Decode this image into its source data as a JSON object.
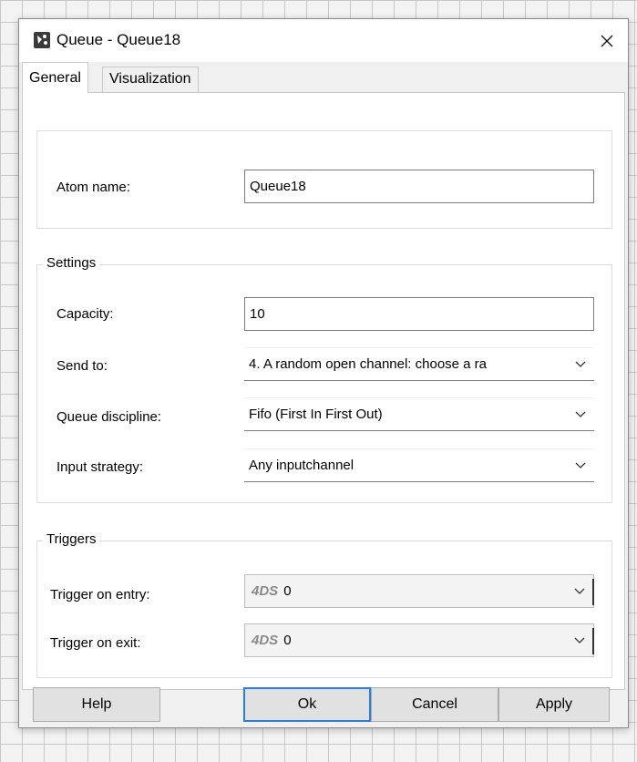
{
  "window": {
    "title": "Queue - Queue18"
  },
  "tabs": [
    {
      "label": "General",
      "active": true
    },
    {
      "label": "Visualization",
      "active": false
    }
  ],
  "atom": {
    "label": "Atom name:",
    "value": "Queue18"
  },
  "settings": {
    "legend": "Settings",
    "capacity": {
      "label": "Capacity:",
      "value": "10"
    },
    "send_to": {
      "label": "Send to:",
      "value": "4. A random open channel: choose a ra"
    },
    "queue_discipline": {
      "label": "Queue discipline:",
      "value": "Fifo (First In First Out)"
    },
    "input_strategy": {
      "label": "Input strategy:",
      "value": "Any inputchannel"
    }
  },
  "triggers": {
    "legend": "Triggers",
    "on_entry": {
      "label": "Trigger on entry:",
      "prefix": "4DS",
      "value": "0"
    },
    "on_exit": {
      "label": "Trigger on exit:",
      "prefix": "4DS",
      "value": "0"
    }
  },
  "buttons": {
    "help": "Help",
    "ok": "Ok",
    "cancel": "Cancel",
    "apply": "Apply"
  },
  "icons": {
    "app": "4ds-app-icon",
    "close": "close-icon",
    "dropdown": "chevron-down-icon"
  },
  "colors": {
    "accent": "#2b7de0",
    "panel": "#ffffff",
    "dialog_bg": "#f0f0f0"
  }
}
